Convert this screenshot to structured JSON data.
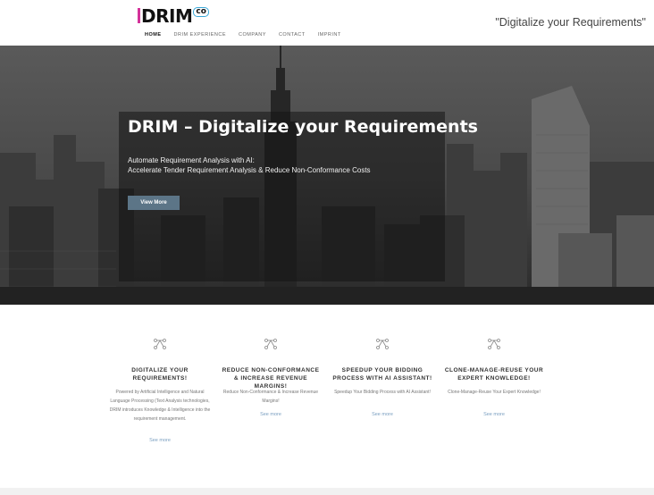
{
  "header": {
    "logo_text": "DRIM",
    "logo_sup": "co",
    "tagline": "\"Digitalize your Requirements\"",
    "nav": [
      "HOME",
      "DRIM EXPERIENCE",
      "COMPANY",
      "CONTACT",
      "IMPRINT"
    ]
  },
  "hero": {
    "title": "DRIM – Digitalize your Requirements",
    "line1": "Automate Requirement Analysis with AI:",
    "line2": "Accelerate Tender Requirement Analysis & Reduce Non-Conformance Costs",
    "button": "View More"
  },
  "features": [
    {
      "title": "DIGITALIZE YOUR REQUIREMENTS!",
      "text": "Powered by Artificial Intelligence and Natural Language Processing (Text Analysis technologies, DRIM introduces Knowledge & Intelligence into the requirement management.",
      "link": "See more"
    },
    {
      "title": "REDUCE NON-CONFORMANCE & INCREASE REVENUE MARGINS!",
      "text": "Reduce Non-Conformance & Increase Revenue Margins!",
      "link": "See more"
    },
    {
      "title": "SPEEDUP YOUR BIDDING PROCESS WITH AI ASSISTANT!",
      "text": "Speedup Your Bidding Process with AI Assistant!",
      "link": "See more"
    },
    {
      "title": "CLONE-MANAGE-REUSE YOUR EXPERT KNOWLEDGE!",
      "text": "Clone-Manage-Reuse Your Expert Knowledge!",
      "link": "See more"
    }
  ],
  "colors": {
    "logo_accent": "#d4329a",
    "logo_ring": "#3aa8d8",
    "button": "#5c7587",
    "link": "#7a9fc0"
  }
}
